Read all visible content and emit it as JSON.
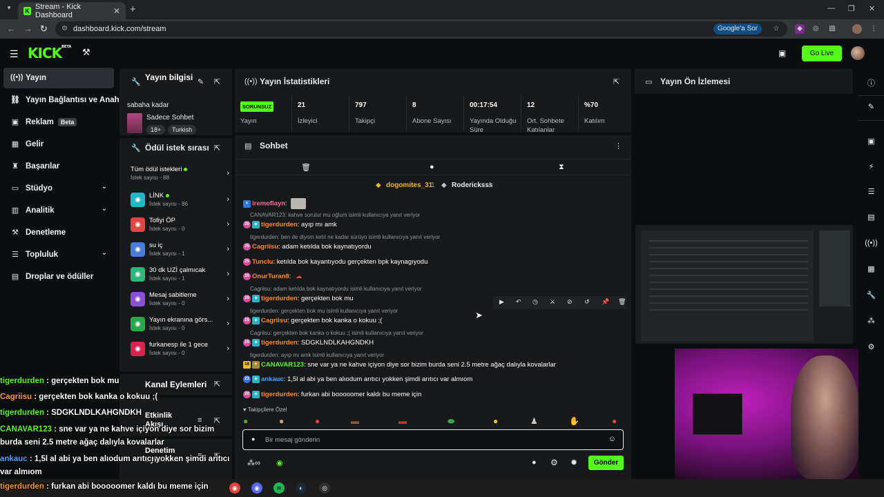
{
  "browser": {
    "tab_title": "Stream - Kick Dashboard",
    "tab_close": "✕",
    "url": "dashboard.kick.com/stream",
    "google_sor": "Google'a Sor"
  },
  "app": {
    "logo": "KICK",
    "logo_beta": "BETA",
    "go_live": "Go Live"
  },
  "nav": {
    "items": [
      {
        "label": "Yayın",
        "icon": "((•))"
      },
      {
        "label": "Yayın Bağlantısı ve Anahtar",
        "icon": "🔗"
      },
      {
        "label": "Reklam",
        "badge": "Beta",
        "icon": "▣"
      },
      {
        "label": "Gelir",
        "icon": "▦"
      },
      {
        "label": "Başarılar",
        "icon": "🏆"
      },
      {
        "label": "Stüdyo",
        "icon": "▭"
      },
      {
        "label": "Analitik",
        "icon": "▥"
      },
      {
        "label": "Denetleme",
        "icon": "🔨"
      },
      {
        "label": "Topluluk",
        "icon": "☰"
      },
      {
        "label": "Droplar ve ödüller",
        "icon": "▤"
      }
    ]
  },
  "stream_info": {
    "title": "Yayın bilgisi",
    "subtitle": "sabaha kadar",
    "category": "Sadece Sohbet",
    "tags": [
      "18+",
      "Turkish"
    ]
  },
  "rewards": {
    "title": "Ödül istek sırası",
    "all_label": "Tüm ödül istekleri",
    "all_count": "İstek sayısı - 88",
    "items": [
      {
        "name": "LİNK",
        "count": "İstek sayısı - 86",
        "color": "#20b7c7"
      },
      {
        "name": "Tofiyi ÖP",
        "count": "İstek sayısı - 0",
        "color": "#e0463f"
      },
      {
        "name": "su iç",
        "count": "İstek sayısı - 1",
        "color": "#4a7bd8"
      },
      {
        "name": "30 dk UZİ çalmıcak",
        "count": "İstek sayısı - 1",
        "color": "#2fb67a"
      },
      {
        "name": "Mesaj sabitleme",
        "count": "İstek sayısı - 0",
        "color": "#8b4fd8"
      },
      {
        "name": "Yayın ekranına görs...",
        "count": "İstek sayısı - 0",
        "color": "#27a84a"
      },
      {
        "name": "furkanesp ile 1 gece",
        "count": "İstek sayısı - 0",
        "color": "#d9244e"
      }
    ]
  },
  "side_sections": {
    "kanal": "Kanal Eylemleri",
    "etkinlik": "Etkinlik Akışı",
    "denetim": "Denetim Eylemleri"
  },
  "stats": {
    "title": "Yayın İstatistikleri",
    "status_badge": "SORUNSUZ",
    "items": [
      {
        "value": "",
        "label": "Yayın"
      },
      {
        "value": "21",
        "label": "İzleyici"
      },
      {
        "value": "797",
        "label": "Takipçi"
      },
      {
        "value": "8",
        "label": "Abone Sayısı"
      },
      {
        "value": "00:17:54",
        "label": "Yayında Olduğu Süre"
      },
      {
        "value": "12",
        "label": "Ort. Sohbete Katılanlar"
      },
      {
        "value": "%70",
        "label": "Katılım"
      }
    ]
  },
  "chat": {
    "title": "Sohbet",
    "gifters": [
      {
        "name": "dogomites_31",
        "count": "1"
      },
      {
        "name": "Rodericksss",
        "count": "1"
      }
    ],
    "rows": [
      {
        "type": "msg",
        "user": "iremoflayn",
        "color": "#ff6b9a",
        "text": ":",
        "emote": true
      },
      {
        "type": "reply",
        "text": "CANAVAR123: kahve sorulur mu oğlum isimli kullanıcıya yanıt veriyor"
      },
      {
        "type": "msg",
        "user": "tigerdurden",
        "color": "#ff8a1c",
        "text": ": ayıp mı amk",
        "badges": [
          "20",
          "sq"
        ]
      },
      {
        "type": "reply",
        "text": "tigerdurden: ben de diyom ketıl ne kadar sürüyo isimli kullanıcıya yanıt veriyor"
      },
      {
        "type": "msg",
        "user": "Cagriisu",
        "color": "#ff8a1c",
        "text": ": adam ketılda bok kaynatıyordu",
        "badges": [
          "25"
        ]
      },
      {
        "type": "msg",
        "user": "Tunclu",
        "color": "#ff8a1c",
        "text": ": ketılda bok kayantıyodu gerçekten bpk kaynagıyodu",
        "badges": [
          "25"
        ]
      },
      {
        "type": "msg",
        "user": "OnurTuran8",
        "color": "#ff8a1c",
        "text": ":",
        "badges": [
          "20"
        ],
        "emote": true
      },
      {
        "type": "reply",
        "text": "Cagriisu: adam ketılda bok kaynatıyordu isimli kullanıcıya yanıt veriyor"
      },
      {
        "type": "msg",
        "user": "tigerdurden",
        "color": "#ff8a1c",
        "text": ": gerçekten bok mu",
        "badges": [
          "20",
          "sq"
        ]
      },
      {
        "type": "reply",
        "text": "tigerdurden: gerçekten bok mu isimli kullanıcıya yanıt veriyor"
      },
      {
        "type": "msg",
        "user": "Cagriisu",
        "color": "#ff8a1c",
        "text": ": gerçekten bok kanka o kokuu ;(",
        "badges": [
          "25",
          "sq"
        ]
      },
      {
        "type": "reply",
        "text": "Cagriisu: gerçekten bok kanka o kokuu ;( isimli kullanıcıya yanıt veriyor"
      },
      {
        "type": "msg",
        "user": "tigerdurden",
        "color": "#ff8a1c",
        "text": ": SDGKLNDLKAHGNDKH",
        "badges": [
          "20",
          "sq"
        ]
      },
      {
        "type": "reply",
        "text": "tigerdurden: ayıp mı amk isimli kullanıcıya yanıt veriyor"
      },
      {
        "type": "msg",
        "user": "CANAVAR123",
        "color": "#53fc18",
        "text": ": sne var ya ne kahve içiyon diye sor bizim burda seni 2.5 metre ağaç dalıyla kovalarlar",
        "badges": [
          "18",
          "sq"
        ]
      },
      {
        "type": "msg",
        "user": "ankauc",
        "color": "#4aa3ff",
        "text": ": 1,5l al abi ya ben alıodum arıtıcı yokken şimdi arıtıcı var almıom",
        "badges": [
          "23",
          "sq"
        ]
      },
      {
        "type": "msg",
        "user": "tigerdurden",
        "color": "#ff8a1c",
        "text": ": furkan abi booooomer kaldı bu meme için",
        "badges": [
          "20",
          "sq"
        ]
      }
    ],
    "emote_label": "Takipçilere Özel",
    "input_placeholder": "Bir mesaj gönderin",
    "infinity": "∞",
    "send": "Gönder"
  },
  "preview": {
    "title": "Yayın Ön İzlemesi"
  },
  "overlay": [
    {
      "user": "tigerdurden",
      "text": " : gerçekten bok mu",
      "color": "#53fc18"
    },
    {
      "user": "Cagriisu",
      "text": " : gerçekten bok kanka o kokuu ;(",
      "color": "#ff9a1c"
    },
    {
      "user": "tigerdurden",
      "text": " : SDGKLNDLKAHGNDKH",
      "color": "#53fc18"
    },
    {
      "user": "CANAVAR123",
      "text": " : sne var ya ne kahve içiyon diye sor bizim burda seni 2.5 metre ağaç dalıyla kovalarlar",
      "color": "#53fc18"
    },
    {
      "user": "ankauc",
      "text": " : 1,5l al abi ya ben alıodum arıtıcı yokken şimdi arıtıcı var almıom",
      "color": "#4aa3ff"
    },
    {
      "user": "tigerdurden",
      "text": " : furkan abi booooomer kaldı bu meme için",
      "color": "#ff9a1c"
    }
  ],
  "colors": {
    "brand": "#53fc18",
    "panel": "#18191b",
    "bg": "#0b0e0f"
  }
}
